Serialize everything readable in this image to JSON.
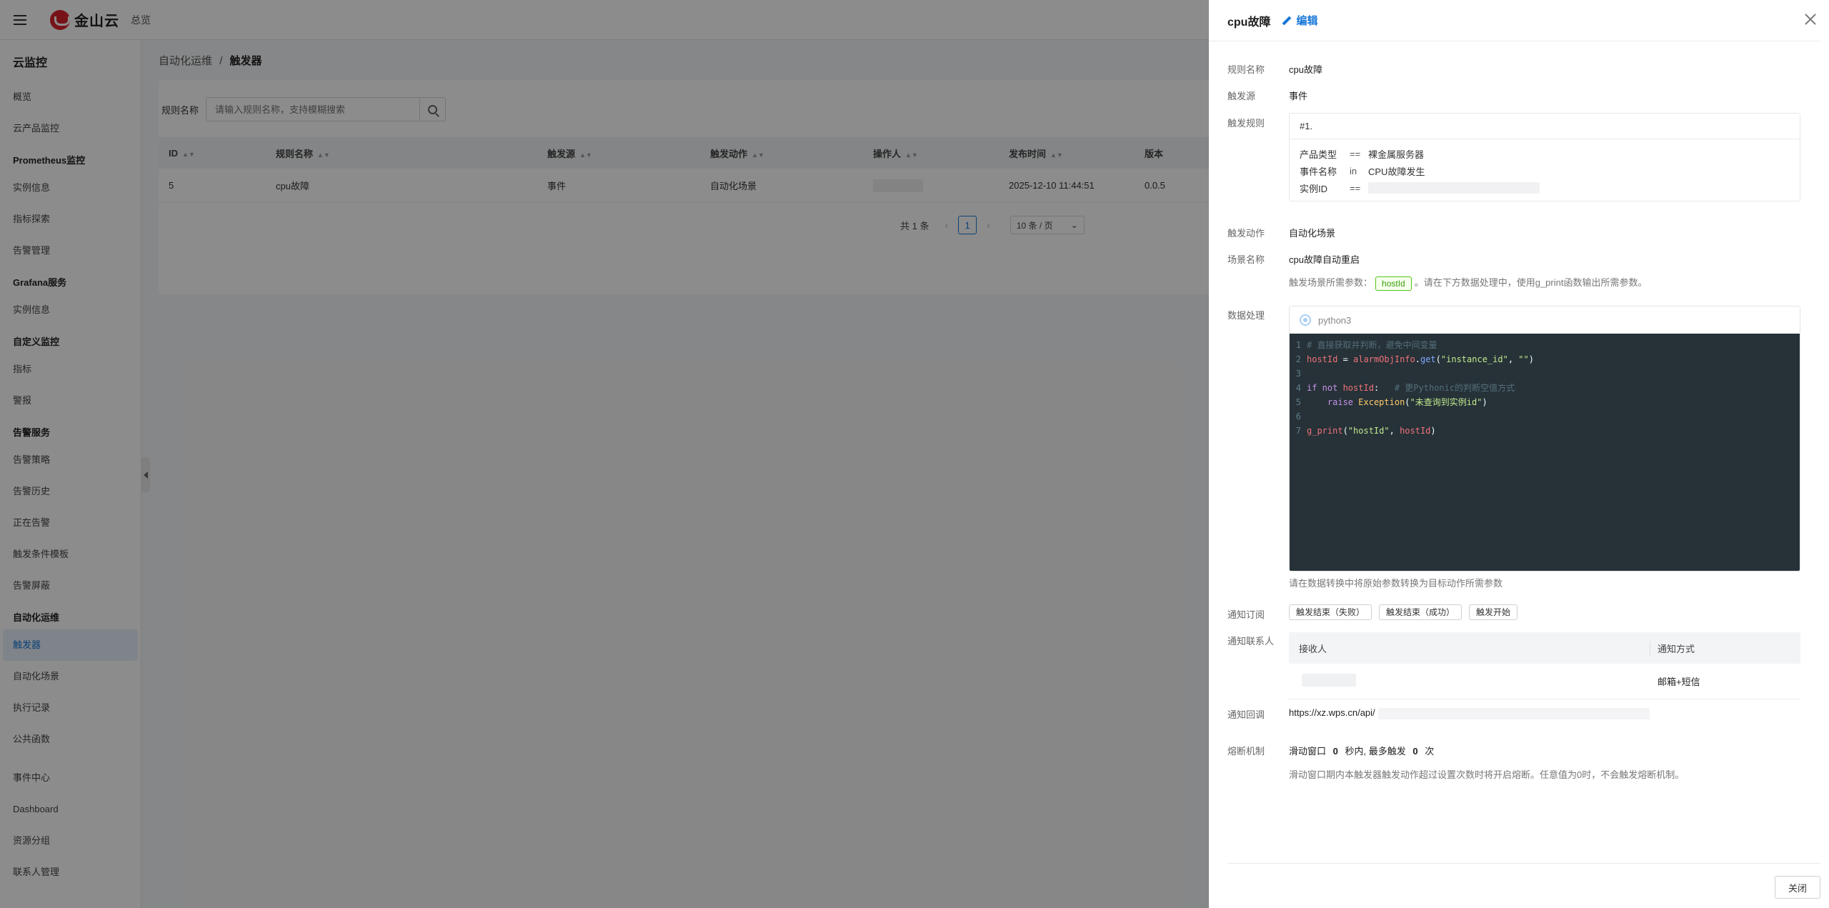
{
  "topbar": {
    "brand": "金山云",
    "overview": "总览"
  },
  "sidebar": {
    "title": "云监控",
    "sections": [
      {
        "group": "",
        "items": [
          "概览",
          "云产品监控"
        ]
      },
      {
        "group": "Prometheus监控",
        "items": [
          "实例信息",
          "指标探索",
          "告警管理"
        ]
      },
      {
        "group": "Grafana服务",
        "items": [
          "实例信息"
        ]
      },
      {
        "group": "自定义监控",
        "items": [
          "指标",
          "警报"
        ]
      },
      {
        "group": "告警服务",
        "items": [
          "告警策略",
          "告警历史",
          "正在告警",
          "触发条件模板",
          "告警屏蔽"
        ]
      },
      {
        "group": "自动化运维",
        "items": [
          "触发器",
          "自动化场景",
          "执行记录",
          "公共函数"
        ]
      },
      {
        "group": "",
        "items": [
          "事件中心",
          "Dashboard",
          "资源分组",
          "联系人管理"
        ]
      }
    ],
    "active": "触发器"
  },
  "breadcrumb": {
    "parent": "自动化运维",
    "sep": "/",
    "current": "触发器"
  },
  "search": {
    "label": "规则名称",
    "placeholder": "请输入规则名称，支持模糊搜索"
  },
  "table": {
    "headers": [
      "ID",
      "规则名称",
      "触发源",
      "触发动作",
      "操作人",
      "发布时间",
      "版本"
    ],
    "rows": [
      {
        "id": "5",
        "name": "cpu故障",
        "source": "事件",
        "action": "自动化场景",
        "time": "2025-12-10 11:44:51",
        "version": "0.0.5"
      }
    ]
  },
  "pager": {
    "total": "共 1 条",
    "page": "1",
    "size": "10 条 / 页"
  },
  "drawer": {
    "title": "cpu故障",
    "edit": "编辑",
    "fields": {
      "rule_name_label": "规则名称",
      "rule_name": "cpu故障",
      "source_label": "触发源",
      "source": "事件",
      "rule_label": "触发规则",
      "action_label": "触发动作",
      "action": "自动化场景",
      "scene_label": "场景名称",
      "scene": "cpu故障自动重启",
      "scene_param_prefix": "触发场景所需参数：",
      "scene_param": "hostId",
      "scene_param_suffix": "。请在下方数据处理中，使用g_print函数输出所需参数。",
      "data_label": "数据处理",
      "lang": "python3",
      "data_hint": "请在数据转换中将原始参数转换为目标动作所需参数",
      "subscribe_label": "通知订阅",
      "contacts_label": "通知联系人",
      "callback_label": "通知回调",
      "callback": "https://xz.wps.cn/api/",
      "breaker_label": "熔断机制",
      "breaker_hint": "滑动窗口期内本触发器触发动作超过设置次数时将开启熔断。任意值为0时，不会触发熔断机制。"
    },
    "rule": {
      "head": "#1.",
      "lines": [
        {
          "k": "产品类型",
          "op": "==",
          "v": "裸金属服务器"
        },
        {
          "k": "事件名称",
          "op": "in",
          "v": "CPU故障发生"
        },
        {
          "k": "实例ID",
          "op": "==",
          "v": ""
        }
      ]
    },
    "code": [
      "# 直接获取并判断，避免中间变量",
      "hostId = alarmObjInfo.get(\"instance_id\", \"\")",
      "",
      "if not hostId:   # 更Pythonic的判断空值方式",
      "    raise Exception(\"未查询到实例id\")",
      "",
      "g_print(\"hostId\", hostId)"
    ],
    "subscriptions": [
      "触发结束（失败）",
      "触发结束（成功）",
      "触发开始"
    ],
    "contacts": {
      "col_receiver": "接收人",
      "col_method": "通知方式",
      "rows": [
        {
          "method": "邮箱+短信"
        }
      ]
    },
    "breaker": {
      "pre": "滑动窗口",
      "window": "0",
      "mid": "秒内, 最多触发",
      "count": "0",
      "post": "次"
    },
    "close": "关闭"
  }
}
